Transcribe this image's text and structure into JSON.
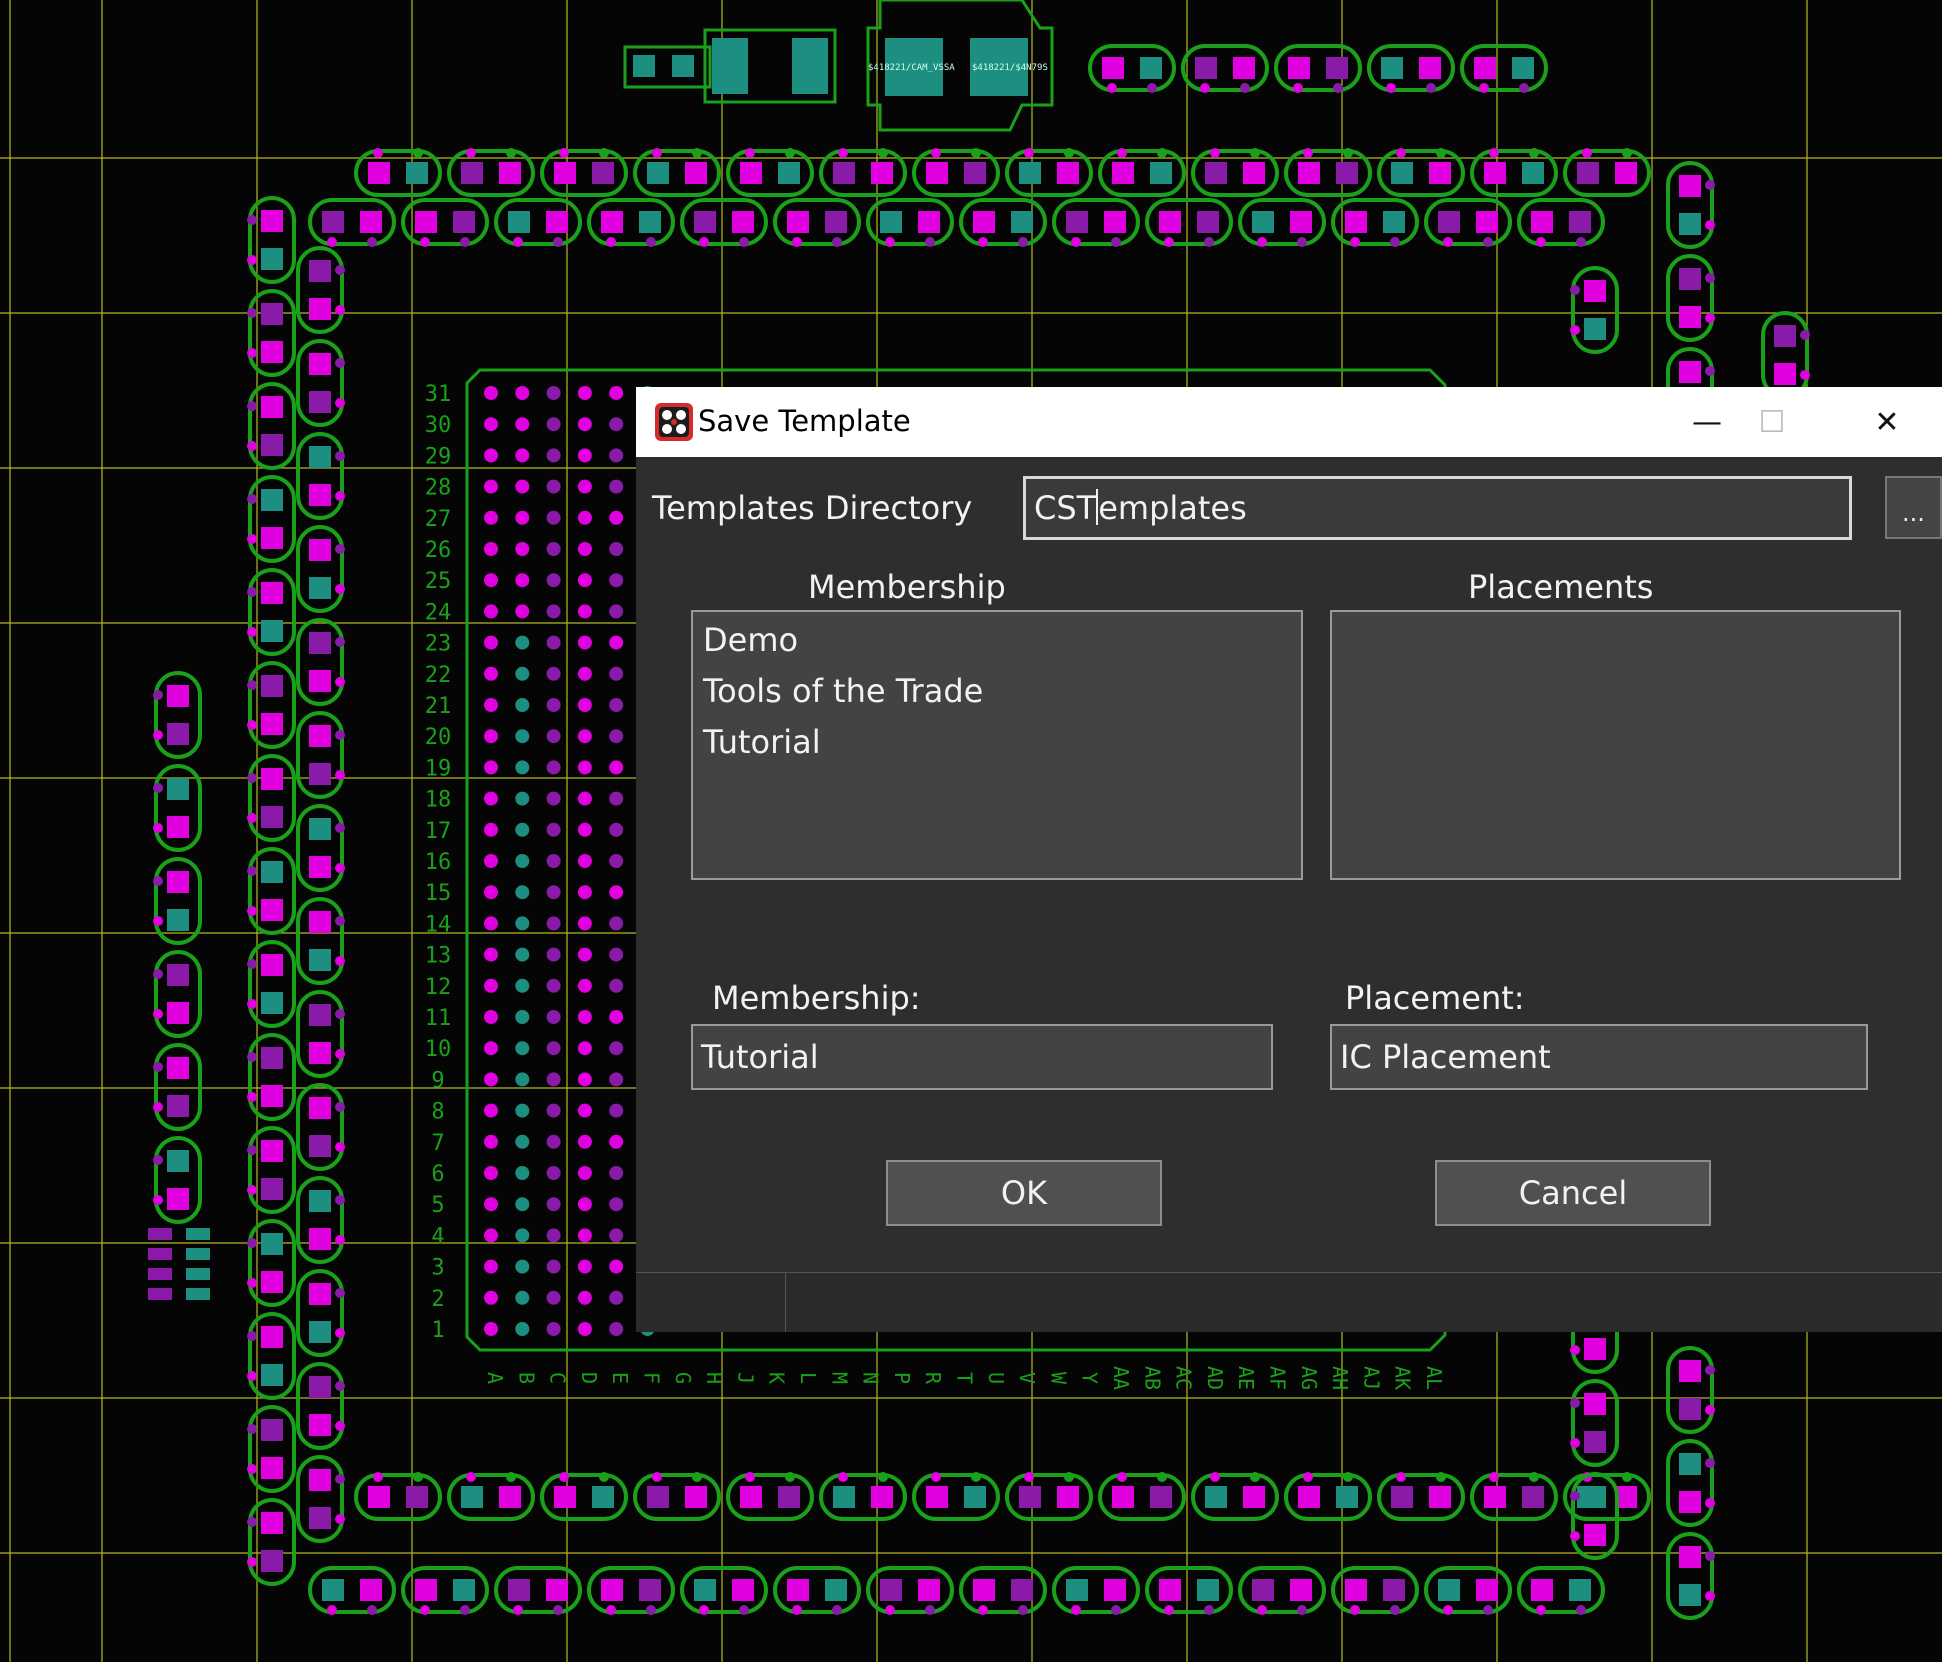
{
  "window": {
    "title": "Save Template",
    "minimize_glyph": "—",
    "maximize_glyph": "☐",
    "close_glyph": "✕"
  },
  "templates_directory": {
    "label": "Templates Directory",
    "value_before_caret": "CST",
    "value_after_caret": "emplates",
    "browse_label": "..."
  },
  "membership_list": {
    "header": "Membership",
    "items": [
      "Demo",
      "Tools of the Trade",
      "Tutorial"
    ]
  },
  "placements_list": {
    "header": "Placements",
    "items": []
  },
  "membership_field": {
    "label": "Membership:",
    "value": "Tutorial"
  },
  "placement_field": {
    "label": "Placement:",
    "value": "IC Placement"
  },
  "buttons": {
    "ok": "OK",
    "cancel": "Cancel"
  },
  "pcb": {
    "row_numbers": [
      "31",
      "30",
      "29",
      "28",
      "27",
      "26",
      "25",
      "24",
      "23",
      "22",
      "21",
      "20",
      "19",
      "18",
      "17",
      "16",
      "15",
      "14",
      "13",
      "12",
      "11",
      "10",
      "9",
      "8",
      "7",
      "6",
      "5",
      "4",
      "3",
      "2",
      "1"
    ],
    "column_letters": [
      "A",
      "B",
      "C",
      "D",
      "E",
      "F",
      "G",
      "H",
      "J",
      "K",
      "L",
      "M",
      "N",
      "P",
      "R",
      "T",
      "U",
      "V",
      "W",
      "Y",
      "AA",
      "AB",
      "AC",
      "AD",
      "AE",
      "AF",
      "AG",
      "AH",
      "AJ",
      "AK",
      "AL"
    ],
    "component_labels": [
      "$418221/CAM_VSSA",
      "$418221/$4N79S"
    ],
    "colors": {
      "background": "#050505",
      "grid": "#b8b820",
      "outline": "#1aa01a",
      "pad_magenta": "#e000e0",
      "pad_purple": "#8a1aa8",
      "pad_teal": "#1c8f80"
    }
  }
}
